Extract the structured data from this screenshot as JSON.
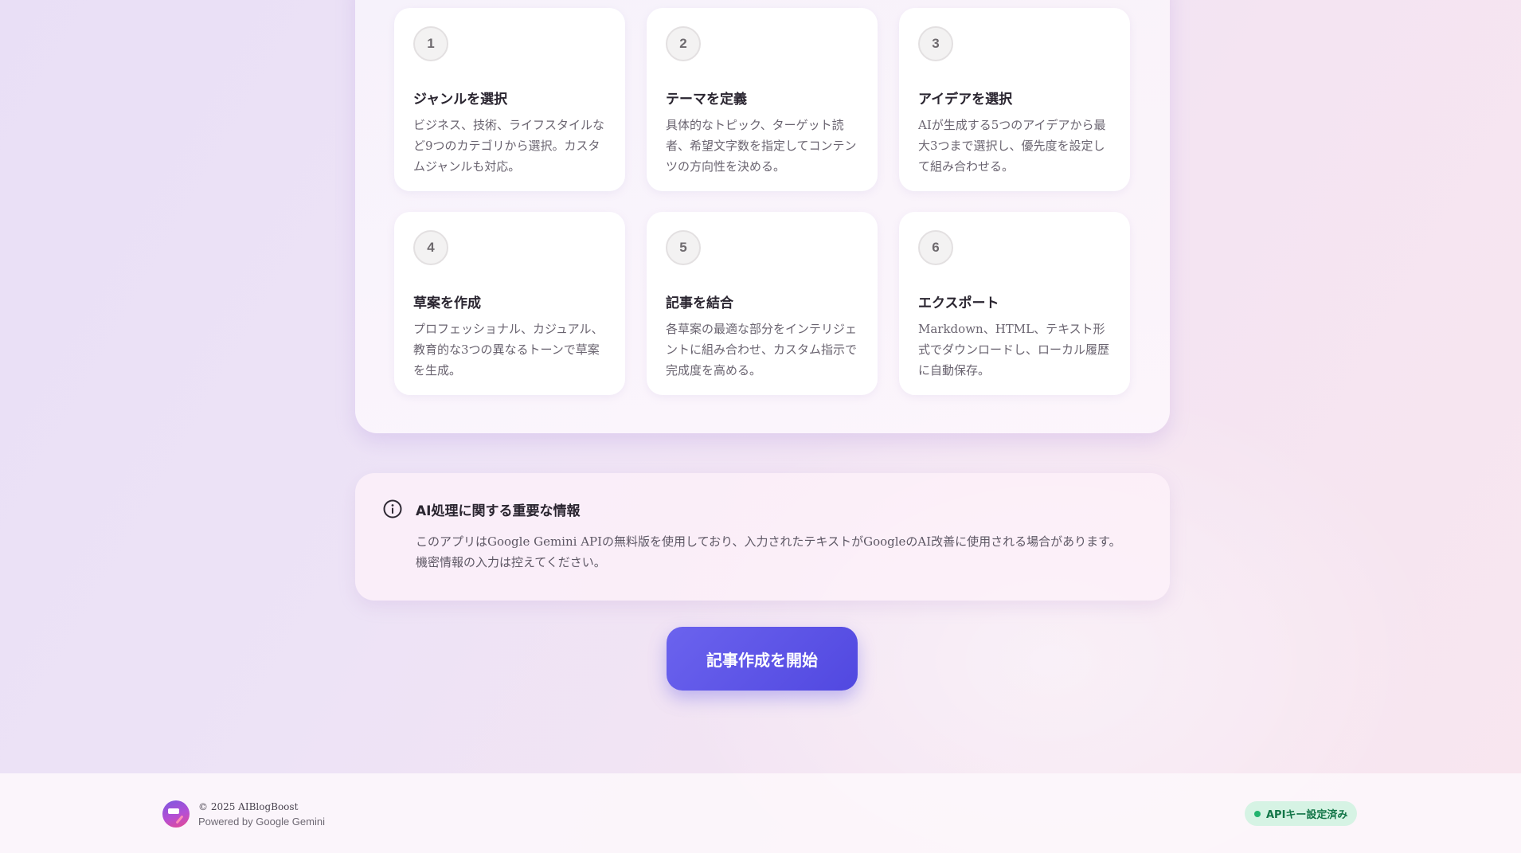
{
  "steps": [
    {
      "number": "1",
      "title": "ジャンルを選択",
      "description": "ビジネス、技術、ライフスタイルなど9つのカテゴリから選択。カスタムジャンルも対応。"
    },
    {
      "number": "2",
      "title": "テーマを定義",
      "description": "具体的なトピック、ターゲット読者、希望文字数を指定してコンテンツの方向性を決める。"
    },
    {
      "number": "3",
      "title": "アイデアを選択",
      "description": "AIが生成する5つのアイデアから最大3つまで選択し、優先度を設定して組み合わせる。"
    },
    {
      "number": "4",
      "title": "草案を作成",
      "description": "プロフェッショナル、カジュアル、教育的な3つの異なるトーンで草案を生成。"
    },
    {
      "number": "5",
      "title": "記事を結合",
      "description": "各草案の最適な部分をインテリジェントに組み合わせ、カスタム指示で完成度を高める。"
    },
    {
      "number": "6",
      "title": "エクスポート",
      "description": "Markdown、HTML、テキスト形式でダウンロードし、ローカル履歴に自動保存。"
    }
  ],
  "info": {
    "icon": "info-icon",
    "title": "AI処理に関する重要な情報",
    "text_line1": "このアプリはGoogle Gemini APIの無料版を使用しており、入力されたテキストがGoogleのAI改善に使用される場合があります。",
    "text_line2": "機密情報の入力は控えてください。"
  },
  "start_button": {
    "label": "記事作成を開始"
  },
  "footer": {
    "copyright": "© 2025 AIBlogBoost",
    "powered_by": "Powered by Google Gemini",
    "api_status": "APIキー設定済み"
  },
  "colors": {
    "accent": "#5b52e6",
    "status_green": "#22b36e",
    "status_bg": "#d6f3e4"
  }
}
